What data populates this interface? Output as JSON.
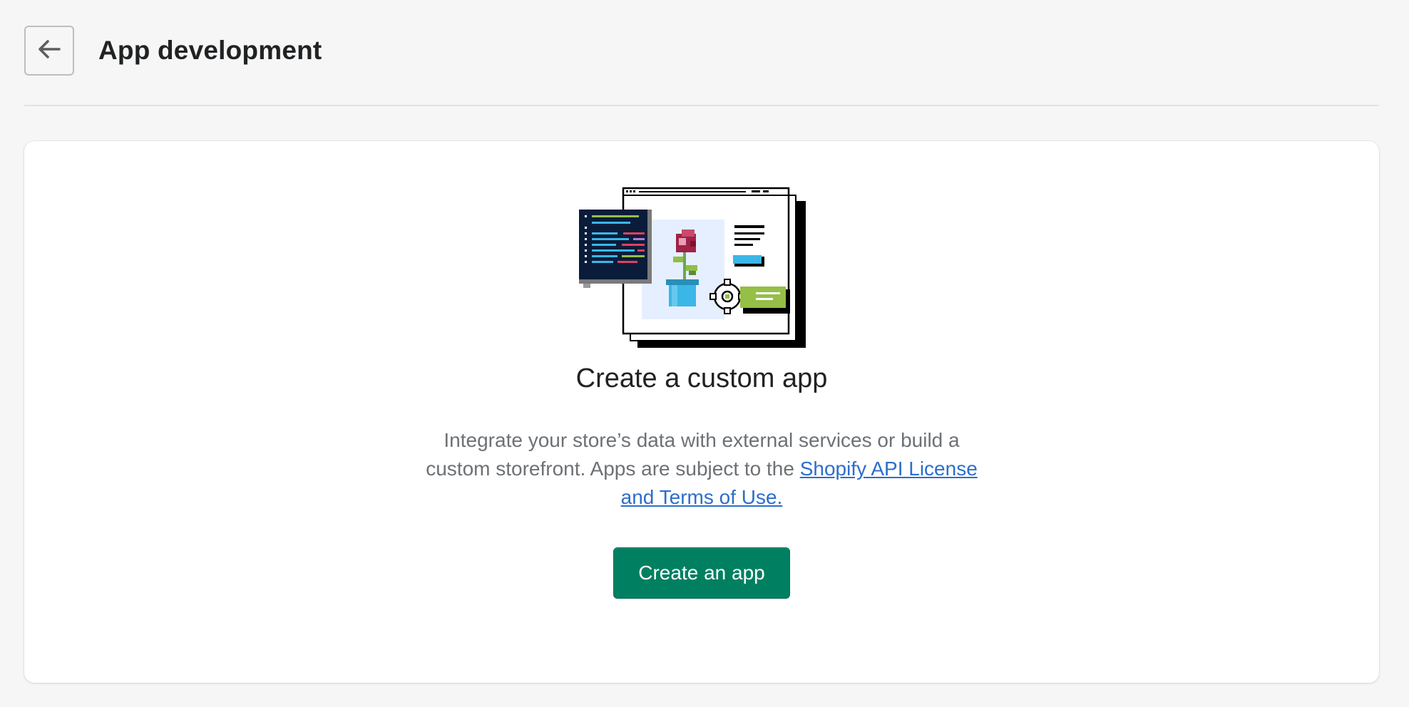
{
  "header": {
    "title": "App development",
    "back_icon": "arrow-left-icon"
  },
  "empty_state": {
    "illustration": "custom-app-illustration",
    "title": "Create a custom app",
    "description_prefix": "Integrate your store’s data with external services or build a custom storefront. Apps are subject to the ",
    "link_text": "Shopify API License and Terms of Use.",
    "button_label": "Create an app"
  },
  "colors": {
    "primary_button": "#008060",
    "link": "#2c6ecb",
    "background": "#f6f6f7",
    "card": "#ffffff"
  }
}
